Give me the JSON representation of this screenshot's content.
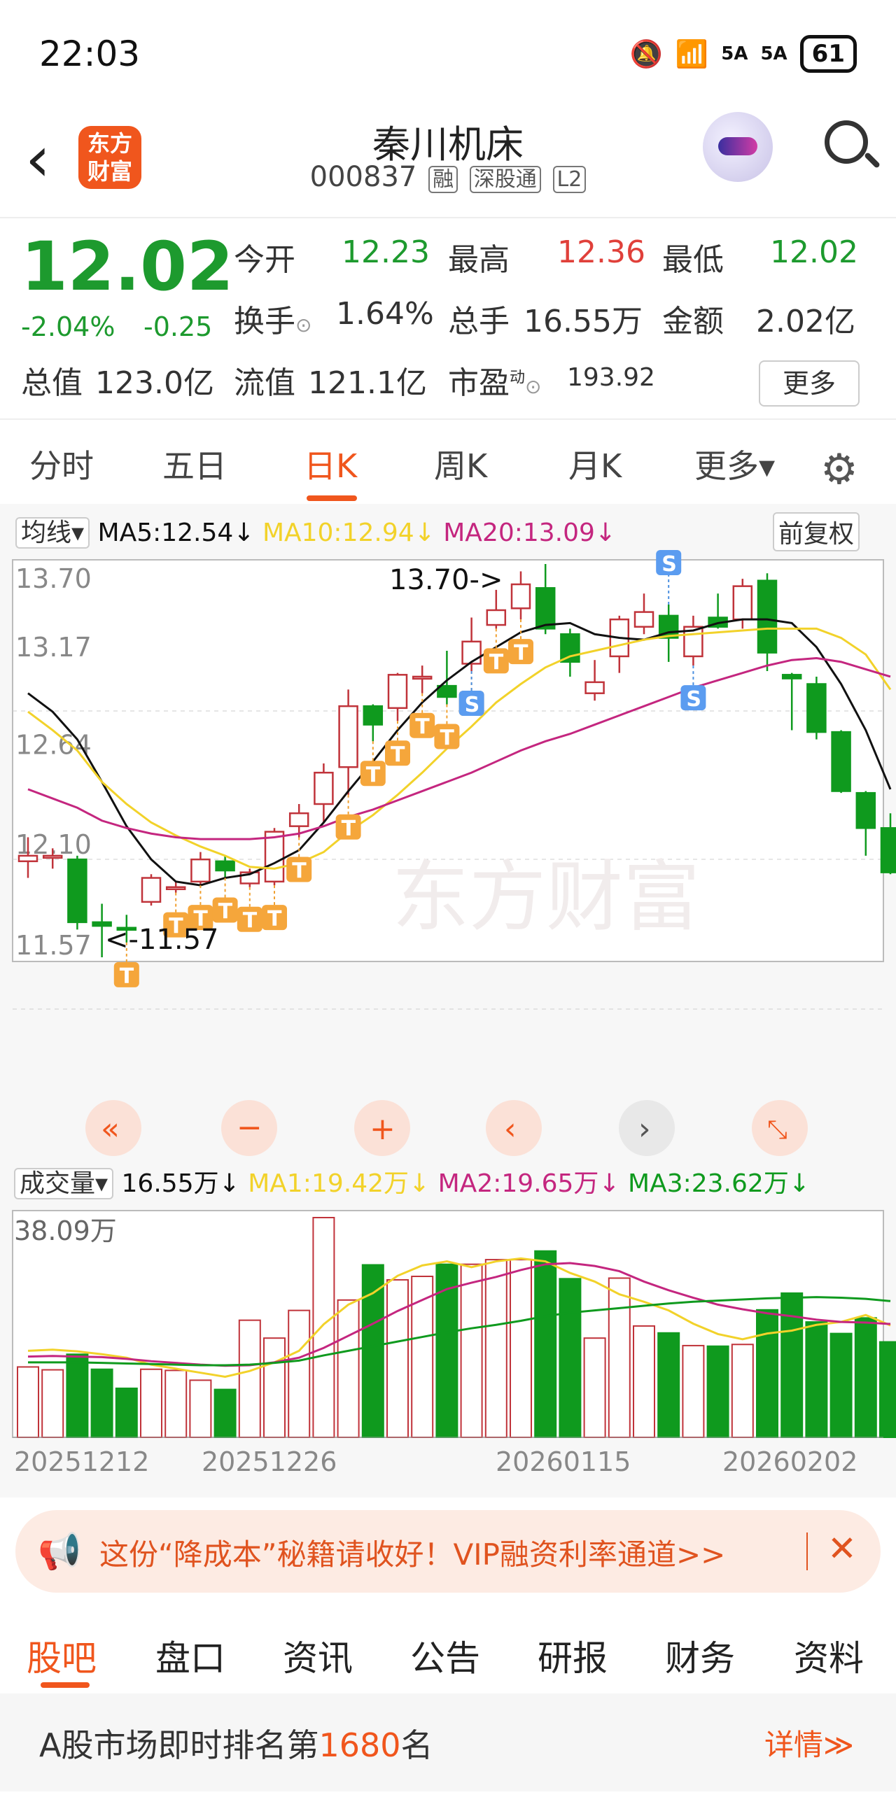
{
  "status": {
    "time": "22:03",
    "net1": "5A",
    "net2": "5A",
    "battery": "61"
  },
  "header": {
    "title": "秦川机床",
    "code": "000837",
    "tags": [
      "融",
      "深股通",
      "L2"
    ],
    "logo_text1": "东方",
    "logo_text2": "财富"
  },
  "quote": {
    "price": "12.02",
    "pct": "-2.04%",
    "chg": "-0.25",
    "open_label": "今开",
    "open": "12.23",
    "high_label": "最高",
    "high": "12.36",
    "low_label": "最低",
    "low": "12.02",
    "turnover_label": "换手",
    "turnover": "1.64%",
    "volume_label": "总手",
    "volume": "16.55万",
    "amount_label": "金额",
    "amount": "2.02亿",
    "mktcap_label": "总值",
    "mktcap": "123.0亿",
    "float_label": "流值",
    "float": "121.1亿",
    "pe_label": "市盈",
    "pe_sup": "动",
    "pe": "193.92",
    "more": "更多"
  },
  "tabs": [
    "分时",
    "五日",
    "日K",
    "周K",
    "月K",
    "更多▾"
  ],
  "kline": {
    "ma_selector": "均线▾",
    "ma5": "MA5:12.54↓",
    "ma10": "MA10:12.94↓",
    "ma20": "MA20:13.09↓",
    "adjust": "前复权",
    "y_labels": [
      "13.70",
      "13.17",
      "12.64",
      "12.10",
      "11.57"
    ],
    "high_note": "13.70->",
    "low_note": "<-11.57",
    "watermark": "东方财富"
  },
  "volume": {
    "selector": "成交量▾",
    "vol": "16.55万↓",
    "ma1": "MA1:19.42万↓",
    "ma2": "MA2:19.65万↓",
    "ma3": "MA3:23.62万↓",
    "max_label": "38.09万",
    "dates": [
      "20251212",
      "20251226",
      "20260115",
      "20260202"
    ]
  },
  "chart_data": {
    "type": "candlestick",
    "ylim": [
      11.57,
      13.7
    ],
    "candles": [
      {
        "o": 12.09,
        "c": 12.12,
        "h": 12.22,
        "l": 12.0
      },
      {
        "o": 12.12,
        "c": 12.12,
        "h": 12.16,
        "l": 12.05
      },
      {
        "o": 12.1,
        "c": 11.76,
        "h": 12.12,
        "l": 11.72
      },
      {
        "o": 11.76,
        "c": 11.74,
        "h": 11.86,
        "l": 11.57
      },
      {
        "o": 11.73,
        "c": 11.72,
        "h": 11.8,
        "l": 11.65
      },
      {
        "o": 11.87,
        "c": 12.0,
        "h": 12.02,
        "l": 11.85
      },
      {
        "o": 11.95,
        "c": 11.95,
        "h": 11.98,
        "l": 11.92
      },
      {
        "o": 11.98,
        "c": 12.1,
        "h": 12.14,
        "l": 11.96
      },
      {
        "o": 12.09,
        "c": 12.04,
        "h": 12.12,
        "l": 12.0
      },
      {
        "o": 11.97,
        "c": 12.03,
        "h": 12.05,
        "l": 11.95
      },
      {
        "o": 11.98,
        "c": 12.25,
        "h": 12.27,
        "l": 11.96
      },
      {
        "o": 12.28,
        "c": 12.35,
        "h": 12.4,
        "l": 12.22
      },
      {
        "o": 12.4,
        "c": 12.57,
        "h": 12.62,
        "l": 12.3
      },
      {
        "o": 12.6,
        "c": 12.93,
        "h": 13.02,
        "l": 12.45
      },
      {
        "o": 12.93,
        "c": 12.83,
        "h": 12.94,
        "l": 12.74
      },
      {
        "o": 12.92,
        "c": 13.1,
        "h": 13.11,
        "l": 12.85
      },
      {
        "o": 13.09,
        "c": 13.09,
        "h": 13.15,
        "l": 13.0
      },
      {
        "o": 13.04,
        "c": 12.98,
        "h": 13.23,
        "l": 12.94
      },
      {
        "o": 13.16,
        "c": 13.28,
        "h": 13.41,
        "l": 13.12
      },
      {
        "o": 13.37,
        "c": 13.45,
        "h": 13.56,
        "l": 13.35
      },
      {
        "o": 13.46,
        "c": 13.59,
        "h": 13.66,
        "l": 13.4
      },
      {
        "o": 13.57,
        "c": 13.35,
        "h": 13.7,
        "l": 13.32
      },
      {
        "o": 13.32,
        "c": 13.17,
        "h": 13.35,
        "l": 13.09
      },
      {
        "o": 13.0,
        "c": 13.06,
        "h": 13.18,
        "l": 12.96
      },
      {
        "o": 13.2,
        "c": 13.4,
        "h": 13.42,
        "l": 13.11
      },
      {
        "o": 13.36,
        "c": 13.44,
        "h": 13.54,
        "l": 13.32
      },
      {
        "o": 13.42,
        "c": 13.3,
        "h": 13.48,
        "l": 13.17
      },
      {
        "o": 13.2,
        "c": 13.36,
        "h": 13.42,
        "l": 13.15
      },
      {
        "o": 13.41,
        "c": 13.36,
        "h": 13.54,
        "l": 13.35
      },
      {
        "o": 13.4,
        "c": 13.58,
        "h": 13.62,
        "l": 13.35
      },
      {
        "o": 13.61,
        "c": 13.22,
        "h": 13.65,
        "l": 13.12
      },
      {
        "o": 13.1,
        "c": 13.08,
        "h": 13.11,
        "l": 12.8
      },
      {
        "o": 13.05,
        "c": 12.79,
        "h": 13.09,
        "l": 12.75
      },
      {
        "o": 12.79,
        "c": 12.47,
        "h": 12.8,
        "l": 12.46
      },
      {
        "o": 12.46,
        "c": 12.27,
        "h": 12.47,
        "l": 12.12
      },
      {
        "o": 12.27,
        "c": 12.03,
        "h": 12.35,
        "l": 12.02
      }
    ],
    "ma5": [
      13.0,
      12.9,
      12.75,
      12.52,
      12.28,
      12.1,
      11.98,
      11.96,
      12.0,
      12.02,
      12.08,
      12.15,
      12.3,
      12.47,
      12.63,
      12.8,
      12.95,
      13.07,
      13.17,
      13.25,
      13.33,
      13.37,
      13.38,
      13.32,
      13.3,
      13.29,
      13.33,
      13.34,
      13.38,
      13.4,
      13.4,
      13.38,
      13.25,
      13.05,
      12.8,
      12.48
    ],
    "ma10": [
      12.9,
      12.8,
      12.69,
      12.52,
      12.4,
      12.3,
      12.23,
      12.17,
      12.12,
      12.06,
      12.05,
      12.08,
      12.14,
      12.25,
      12.34,
      12.45,
      12.57,
      12.7,
      12.82,
      12.95,
      13.05,
      13.14,
      13.2,
      13.23,
      13.26,
      13.29,
      13.31,
      13.32,
      13.33,
      13.34,
      13.35,
      13.35,
      13.35,
      13.3,
      13.21,
      13.02
    ],
    "ma20": [
      12.48,
      12.43,
      12.38,
      12.31,
      12.27,
      12.24,
      12.22,
      12.21,
      12.21,
      12.21,
      12.22,
      12.24,
      12.28,
      12.33,
      12.37,
      12.42,
      12.47,
      12.52,
      12.57,
      12.63,
      12.69,
      12.74,
      12.78,
      12.83,
      12.88,
      12.93,
      12.98,
      13.03,
      13.07,
      13.11,
      13.15,
      13.18,
      13.19,
      13.17,
      13.13,
      13.09
    ],
    "volume": {
      "max": 38.09,
      "values": [
        12.2,
        11.7,
        14.4,
        11.8,
        8.5,
        11.8,
        11.6,
        9.9,
        8.3,
        20.3,
        17.2,
        22.0,
        38.09,
        23.8,
        29.9,
        27.3,
        27.9,
        30.0,
        30.0,
        30.8,
        30.8,
        32.3,
        27.5,
        17.2,
        27.6,
        19.3,
        18.1,
        15.9,
        15.8,
        16.1,
        22.1,
        25.0,
        20.0,
        18.0,
        20.7,
        16.55
      ],
      "ma1": [
        15.0,
        15.2,
        14.9,
        14.4,
        13.8,
        12.6,
        11.9,
        11.2,
        10.5,
        11.5,
        13.0,
        15.0,
        19.6,
        23.0,
        25.0,
        28.0,
        29.8,
        30.5,
        29.5,
        30.5,
        31.0,
        30.5,
        28.5,
        27.0,
        24.8,
        23.5,
        22.0,
        19.7,
        17.9,
        17.0,
        18.0,
        18.5,
        19.5,
        20.0,
        21.2,
        19.4
      ],
      "ma2": [
        14.0,
        14.1,
        14.0,
        13.9,
        13.6,
        13.2,
        12.9,
        12.6,
        12.4,
        12.5,
        13.0,
        13.8,
        15.5,
        17.6,
        19.7,
        21.9,
        23.8,
        25.7,
        26.8,
        27.8,
        29.0,
        30.0,
        30.2,
        29.7,
        28.8,
        27.0,
        25.5,
        24.2,
        23.0,
        22.2,
        21.5,
        21.0,
        20.4,
        20.0,
        19.9,
        19.65
      ],
      "ma3": [
        13.0,
        13.0,
        13.0,
        12.9,
        12.8,
        12.7,
        12.6,
        12.5,
        12.5,
        12.6,
        12.9,
        13.3,
        14.2,
        15.0,
        15.8,
        16.6,
        17.4,
        18.2,
        18.9,
        19.5,
        20.2,
        21.0,
        21.6,
        22.0,
        22.4,
        22.8,
        23.2,
        23.5,
        23.7,
        23.9,
        24.1,
        24.2,
        24.3,
        24.2,
        24.0,
        23.62
      ]
    },
    "t_markers": [
      4,
      6,
      7,
      8,
      9,
      10,
      11,
      13,
      14,
      15,
      16,
      17,
      18,
      19,
      20
    ],
    "s_markers": [
      {
        "idx": 18,
        "pos": "below"
      },
      {
        "idx": 26,
        "pos": "above"
      },
      {
        "idx": 27,
        "pos": "below"
      }
    ]
  },
  "promo": {
    "text": "这份“降成本”秘籍请收好！VIP融资利率通道>>",
    "close": "✕"
  },
  "bottom_tabs": [
    "股吧",
    "盘口",
    "资讯",
    "公告",
    "研报",
    "财务",
    "资料"
  ],
  "rank": {
    "prefix": "A股市场即时排名第",
    "num": "1680",
    "suffix": "名",
    "detail": "详情≫"
  },
  "colors": {
    "up": "#c0333a",
    "down": "#0f9a1e",
    "ma5": "#111111",
    "ma10": "#f2d22a",
    "ma20": "#c4267f",
    "accent": "#f0561d"
  }
}
